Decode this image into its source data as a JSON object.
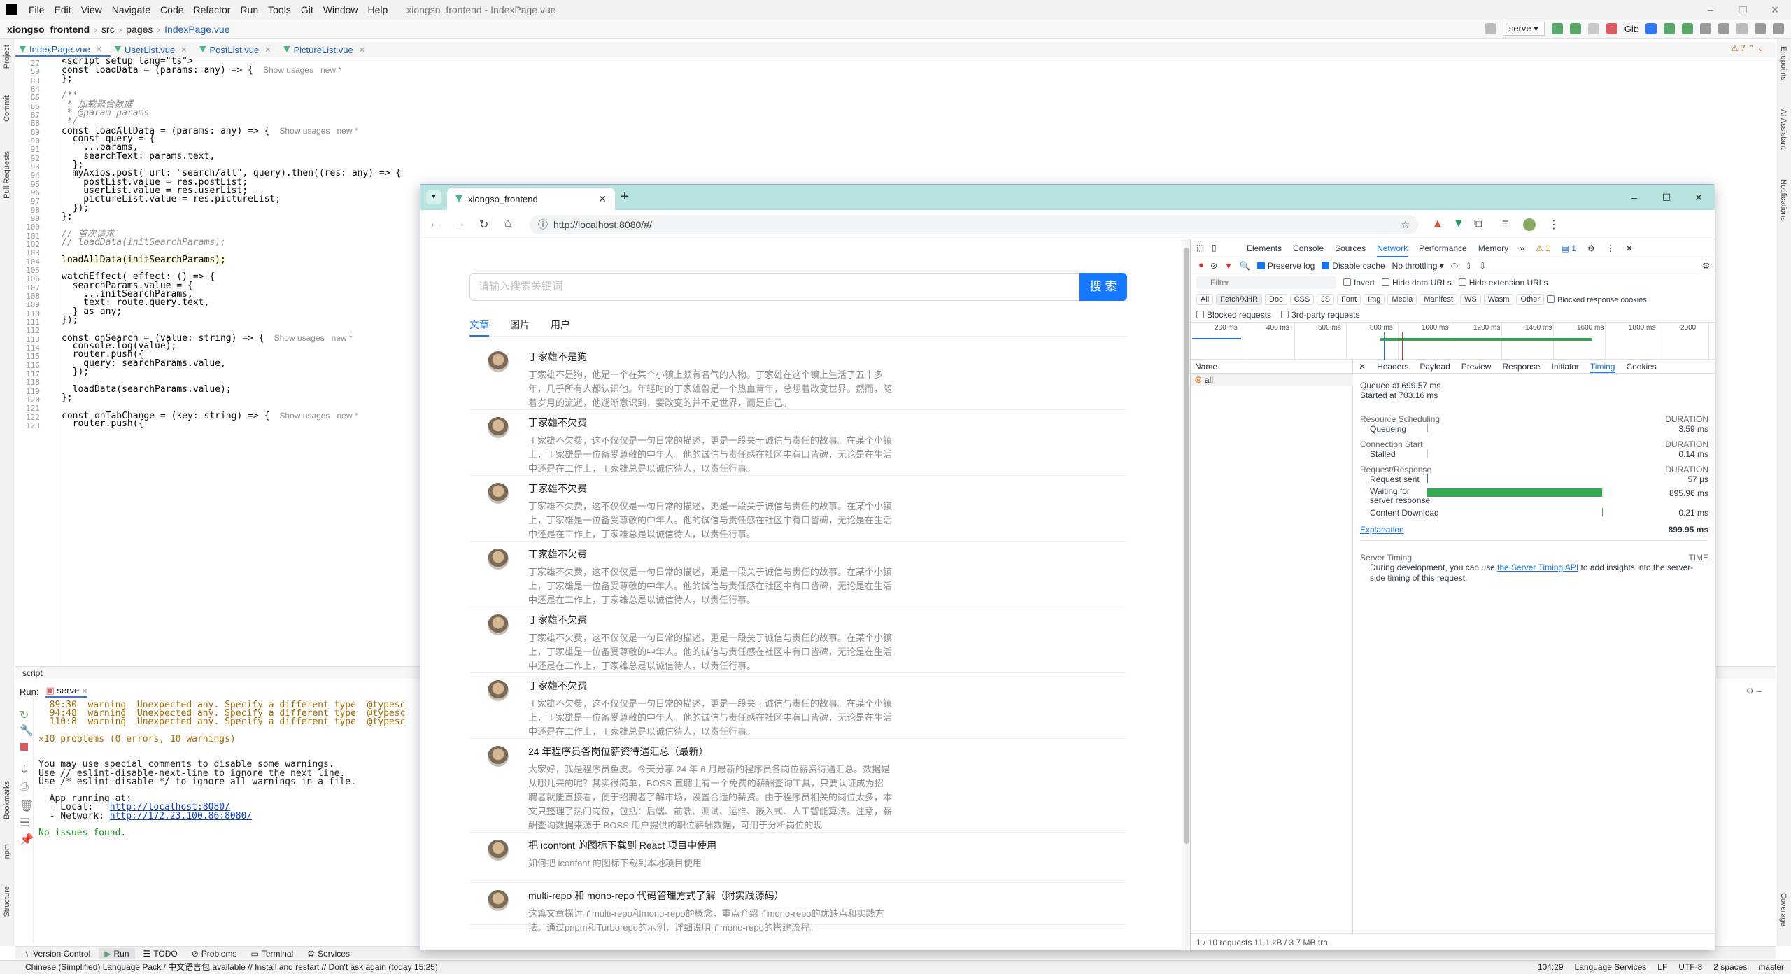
{
  "ide": {
    "project": "xiongso_frontend",
    "menu": [
      "File",
      "Edit",
      "View",
      "Navigate",
      "Code",
      "Refactor",
      "Run",
      "Tools",
      "Git",
      "Window",
      "Help"
    ],
    "window_title": "xiongso_frontend - IndexPage.vue",
    "breadcrumb": [
      "xiongso_frontend",
      "src",
      "pages",
      "IndexPage.vue"
    ],
    "run_config": "serve",
    "git_label": "Git:",
    "warnings_count": "7",
    "left_tools": [
      "Project",
      "Commit",
      "Pull Requests",
      "Bookmarks",
      "npm",
      "Structure"
    ],
    "right_tools": [
      "Endpoints",
      "AI Assistant",
      "Notifications",
      "Coverage"
    ],
    "tabs": [
      "IndexPage.vue",
      "UserList.vue",
      "PostList.vue",
      "PictureList.vue"
    ],
    "editor_status": "script",
    "run_label": "Run:",
    "run_tab": "serve",
    "bottom_tools": [
      "Version Control",
      "Run",
      "TODO",
      "Problems",
      "Terminal",
      "Services"
    ],
    "status_message": "Chinese (Simplified) Language Pack / 中文语言包 available // Install and restart // Don't ask again (today 15:25)",
    "status_right": [
      "104:29",
      "Language Services",
      "LF",
      "UTF-8",
      "2 spaces",
      "master"
    ]
  },
  "code_lines": [
    {
      "n": "27",
      "t": "<script setup lang=\"ts\">"
    },
    {
      "n": "59",
      "t": "const loadData = (params: any) => {",
      "hint": "Show usages   new *"
    },
    {
      "n": "83",
      "t": "};"
    },
    {
      "n": "84",
      "t": ""
    },
    {
      "n": "85",
      "t": "/**"
    },
    {
      "n": "86",
      "t": " * 加载聚合数据"
    },
    {
      "n": "87",
      "t": " * @param params"
    },
    {
      "n": "88",
      "t": " */"
    },
    {
      "n": "89",
      "t": "const loadAllData = (params: any) => {",
      "hint": "Show usages   new *"
    },
    {
      "n": "90",
      "t": "  const query = {"
    },
    {
      "n": "91",
      "t": "    ...params,"
    },
    {
      "n": "92",
      "t": "    searchText: params.text,"
    },
    {
      "n": "93",
      "t": "  };"
    },
    {
      "n": "94",
      "t": "  myAxios.post( url: \"search/all\", query).then((res: any) => {"
    },
    {
      "n": "95",
      "t": "    postList.value = res.postList;"
    },
    {
      "n": "96",
      "t": "    userList.value = res.userList;"
    },
    {
      "n": "97",
      "t": "    pictureList.value = res.pictureList;"
    },
    {
      "n": "98",
      "t": "  });"
    },
    {
      "n": "99",
      "t": "};"
    },
    {
      "n": "100",
      "t": ""
    },
    {
      "n": "101",
      "t": "// 首次请求"
    },
    {
      "n": "102",
      "t": "// loadData(initSearchParams);"
    },
    {
      "n": "103",
      "t": ""
    },
    {
      "n": "104",
      "t": "loadAllData(initSearchParams);"
    },
    {
      "n": "105",
      "t": ""
    },
    {
      "n": "106",
      "t": "watchEffect( effect: () => {"
    },
    {
      "n": "107",
      "t": "  searchParams.value = {"
    },
    {
      "n": "108",
      "t": "    ...initSearchParams,"
    },
    {
      "n": "109",
      "t": "    text: route.query.text,"
    },
    {
      "n": "110",
      "t": "  } as any;"
    },
    {
      "n": "111",
      "t": "});"
    },
    {
      "n": "112",
      "t": ""
    },
    {
      "n": "113",
      "t": "const onSearch = (value: string) => {",
      "hint": "Show usages   new *"
    },
    {
      "n": "114",
      "t": "  console.log(value);"
    },
    {
      "n": "115",
      "t": "  router.push({"
    },
    {
      "n": "116",
      "t": "    query: searchParams.value,"
    },
    {
      "n": "117",
      "t": "  });"
    },
    {
      "n": "118",
      "t": ""
    },
    {
      "n": "119",
      "t": "  loadData(searchParams.value);"
    },
    {
      "n": "120",
      "t": "};"
    },
    {
      "n": "121",
      "t": ""
    },
    {
      "n": "122",
      "t": "const onTabChange = (key: string) => {",
      "hint": "Show usages   new *"
    },
    {
      "n": "123",
      "t": "  router.push({"
    }
  ],
  "run_output": [
    {
      "t": "  89:30  warning  Unexpected any. Specify a different type  @typesc",
      "c": "warn"
    },
    {
      "t": "  94:48  warning  Unexpected any. Specify a different type  @typesc",
      "c": "warn"
    },
    {
      "t": "  110:8  warning  Unexpected any. Specify a different type  @typesc",
      "c": "warn"
    },
    {
      "t": "",
      "c": ""
    },
    {
      "t": "✕10 problems (0 errors, 10 warnings)",
      "c": "warn"
    },
    {
      "t": "",
      "c": ""
    },
    {
      "t": "",
      "c": ""
    },
    {
      "t": "You may use special comments to disable some warnings.",
      "c": ""
    },
    {
      "t": "Use // eslint-disable-next-line to ignore the next line.",
      "c": ""
    },
    {
      "t": "Use /* eslint-disable */ to ignore all warnings in a file.",
      "c": ""
    },
    {
      "t": "",
      "c": ""
    },
    {
      "t": "  App running at:",
      "c": ""
    },
    {
      "t": "  - Local:   http://localhost:8080/",
      "c": "",
      "link": "http://localhost:8080/"
    },
    {
      "t": "  - Network: http://172.23.100.86:8080/",
      "c": "",
      "link": "http://172.23.100.86:8080/"
    },
    {
      "t": "",
      "c": ""
    },
    {
      "t": "No issues found.",
      "c": "grn"
    }
  ],
  "browser": {
    "tab_title": "xiongso_frontend",
    "url": "http://localhost:8080/#/",
    "search_placeholder": "请输入搜索关键词",
    "search_button": "搜 索",
    "tabs": [
      "文章",
      "图片",
      "用户"
    ],
    "posts": [
      {
        "title": "丁家雄不是狗",
        "desc": "丁家雄不是狗，他是一个在某个小镇上颇有名气的人物。丁家雄在这个镇上生活了五十多年，几乎所有人都认识他。年轻时的丁家雄曾是一个热血青年，总想着改变世界。然而，随着岁月的流逝，他逐渐意识到，要改变的并不是世界，而是自己。"
      },
      {
        "title": "丁家雄不欠费",
        "desc": "丁家雄不欠费，这不仅仅是一句日常的描述，更是一段关于诚信与责任的故事。在某个小镇上，丁家雄是一位备受尊敬的中年人。他的诚信与责任感在社区中有口皆碑，无论是在生活中还是在工作上，丁家雄总是以诚信待人，以责任行事。"
      },
      {
        "title": "丁家雄不欠费",
        "desc": "丁家雄不欠费，这不仅仅是一句日常的描述，更是一段关于诚信与责任的故事。在某个小镇上，丁家雄是一位备受尊敬的中年人。他的诚信与责任感在社区中有口皆碑，无论是在生活中还是在工作上，丁家雄总是以诚信待人，以责任行事。"
      },
      {
        "title": "丁家雄不欠费",
        "desc": "丁家雄不欠费，这不仅仅是一句日常的描述，更是一段关于诚信与责任的故事。在某个小镇上，丁家雄是一位备受尊敬的中年人。他的诚信与责任感在社区中有口皆碑，无论是在生活中还是在工作上，丁家雄总是以诚信待人，以责任行事。"
      },
      {
        "title": "丁家雄不欠费",
        "desc": "丁家雄不欠费，这不仅仅是一句日常的描述，更是一段关于诚信与责任的故事。在某个小镇上，丁家雄是一位备受尊敬的中年人。他的诚信与责任感在社区中有口皆碑，无论是在生活中还是在工作上，丁家雄总是以诚信待人，以责任行事。"
      },
      {
        "title": "丁家雄不欠费",
        "desc": "丁家雄不欠费，这不仅仅是一句日常的描述，更是一段关于诚信与责任的故事。在某个小镇上，丁家雄是一位备受尊敬的中年人。他的诚信与责任感在社区中有口皆碑，无论是在生活中还是在工作上，丁家雄总是以诚信待人，以责任行事。"
      },
      {
        "title": "24 年程序员各岗位薪资待遇汇总（最新）",
        "desc": "大家好，我是程序员鱼皮。今天分享 24 年 6 月最新的程序员各岗位薪资待遇汇总。数据是从哪儿来的呢？其实很简单，BOSS 直聘上有一个免费的薪酬查询工具，只要认证成为招聘者就能直接看，便于招聘者了解市场，设置合适的薪资。由于程序员相关的岗位太多，本文只整理了热门岗位，包括：后端、前端、测试、运维、嵌入式、人工智能算法。注意，薪酬查询数据来源于 BOSS 用户提供的职位薪酬数据，可用于分析岗位的现"
      },
      {
        "title": "把 iconfont 的图标下载到 React 项目中使用",
        "desc": "如何把 iconfont 的图标下载到本地项目使用"
      },
      {
        "title": "multi-repo 和 mono-repo 代码管理方式了解（附实践源码）",
        "desc": "这篇文章探讨了multi-repo和mono-repo的概念，重点介绍了mono-repo的优缺点和实践方法。通过pnpm和Turborepo的示例，详细说明了mono-repo的搭建流程。"
      }
    ]
  },
  "devtools": {
    "tabs": [
      "Elements",
      "Console",
      "Sources",
      "Network",
      "Performance",
      "Memory"
    ],
    "active_tab": "Network",
    "issues_warn": "1",
    "issues_msg": "1",
    "preserve_log": "Preserve log",
    "disable_cache": "Disable cache",
    "throttling": "No throttling",
    "filter_placeholder": "Filter",
    "invert": "Invert",
    "hide_data_urls": "Hide data URLs",
    "hide_ext_urls": "Hide extension URLs",
    "types": [
      "All",
      "Fetch/XHR",
      "Doc",
      "CSS",
      "JS",
      "Font",
      "Img",
      "Media",
      "Manifest",
      "WS",
      "Wasm",
      "Other"
    ],
    "blocked_response": "Blocked response cookies",
    "blocked_requests": "Blocked requests",
    "third_party": "3rd-party requests",
    "ticks": [
      "200 ms",
      "400 ms",
      "600 ms",
      "800 ms",
      "1000 ms",
      "1200 ms",
      "1400 ms",
      "1600 ms",
      "1800 ms",
      "2000"
    ],
    "name_header": "Name",
    "request_name": "all",
    "footer": "1 / 10 requests     11.1 kB / 3.7 MB tra",
    "detail_tabs": [
      "Headers",
      "Payload",
      "Preview",
      "Response",
      "Initiator",
      "Timing",
      "Cookies"
    ],
    "active_detail": "Timing",
    "queued": "Queued at 699.57 ms",
    "started": "Started at 703.16 ms",
    "sections": {
      "scheduling": "Resource Scheduling",
      "connection": "Connection Start",
      "reqresp": "Request/Response",
      "duration": "DURATION"
    },
    "rows": {
      "queueing": {
        "label": "Queueing",
        "value": "3.59 ms"
      },
      "stalled": {
        "label": "Stalled",
        "value": "0.14 ms"
      },
      "sent": {
        "label": "Request sent",
        "value": "57 μs"
      },
      "waiting": {
        "label": "Waiting for server response",
        "value": "895.96 ms"
      },
      "download": {
        "label": "Content Download",
        "value": "0.21 ms"
      }
    },
    "explanation": "Explanation",
    "total": "899.95 ms",
    "server_timing": "Server Timing",
    "time_label": "TIME",
    "server_text_1": "During development, you can use ",
    "server_link": "the Server Timing API",
    "server_text_2": " to add insights into the server-side timing of this request.",
    "accent": "#1a73e8",
    "bar_color": "#34a853"
  }
}
